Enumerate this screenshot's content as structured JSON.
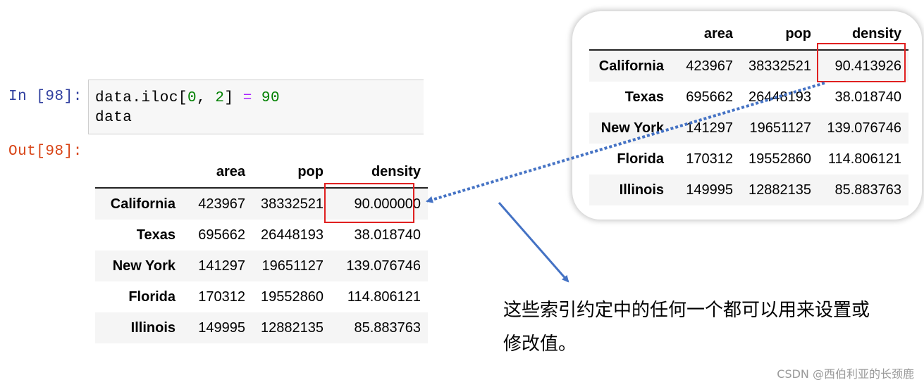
{
  "notebook": {
    "in_prompt": "In [98]:",
    "out_prompt": "Out[98]:",
    "code": {
      "line1_obj": "data.iloc[",
      "line1_idx0": "0",
      "line1_sep": ", ",
      "line1_idx1": "2",
      "line1_close": "] ",
      "line1_op": "=",
      "line1_space": " ",
      "line1_val": "90",
      "line2": "data"
    }
  },
  "output_table": {
    "columns": [
      "area",
      "pop",
      "density"
    ],
    "rows": [
      {
        "index": "California",
        "area": "423967",
        "pop": "38332521",
        "density": "90.000000"
      },
      {
        "index": "Texas",
        "area": "695662",
        "pop": "26448193",
        "density": "38.018740"
      },
      {
        "index": "New York",
        "area": "141297",
        "pop": "19651127",
        "density": "139.076746"
      },
      {
        "index": "Florida",
        "area": "170312",
        "pop": "19552860",
        "density": "114.806121"
      },
      {
        "index": "Illinois",
        "area": "149995",
        "pop": "12882135",
        "density": "85.883763"
      }
    ]
  },
  "original_table": {
    "columns": [
      "area",
      "pop",
      "density"
    ],
    "rows": [
      {
        "index": "California",
        "area": "423967",
        "pop": "38332521",
        "density": "90.413926"
      },
      {
        "index": "Texas",
        "area": "695662",
        "pop": "26448193",
        "density": "38.018740"
      },
      {
        "index": "New York",
        "area": "141297",
        "pop": "19651127",
        "density": "139.076746"
      },
      {
        "index": "Florida",
        "area": "170312",
        "pop": "19552860",
        "density": "114.806121"
      },
      {
        "index": "Illinois",
        "area": "149995",
        "pop": "12882135",
        "density": "85.883763"
      }
    ]
  },
  "annotation": {
    "line1": "这些索引约定中的任何一个都可以用来设置或",
    "line2": "修改值。"
  },
  "colors": {
    "highlight_box": "#e02020",
    "arrow": "#4472c4"
  },
  "watermark": "CSDN @西伯利亚的长颈鹿"
}
